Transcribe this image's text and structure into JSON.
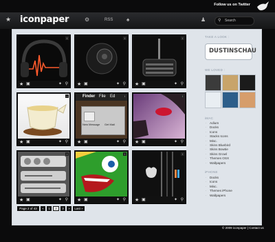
{
  "header": {
    "twitter_text": "Follow us on Twitter",
    "logo": "iconpaper",
    "nav_rss": "RSS",
    "search_placeholder": "Search"
  },
  "tiles": [
    {
      "name": "headphones"
    },
    {
      "name": "speaker"
    },
    {
      "name": "radio"
    },
    {
      "name": "teapot"
    },
    {
      "name": "finder-menu"
    },
    {
      "name": "lips"
    },
    {
      "name": "media-player"
    },
    {
      "name": "green-monster"
    },
    {
      "name": "apple-wallpaper"
    }
  ],
  "finder_tile": {
    "title": "Finder",
    "menu_file": "File",
    "menu_edit": "Ed",
    "btn_new": "New Message",
    "btn_mail": "Get Mail"
  },
  "pager": {
    "label": "Page 2 of 43",
    "prev": "«",
    "p1": "1",
    "p2": "2",
    "p3": "3",
    "next": "»",
    "last": "Last »"
  },
  "sidebar": {
    "take_a_look": "TAKE A LOOK :",
    "dustin": "DUSTINSCHAU",
    "we_loved": "WE LOVED :",
    "imac_heading": "iMAC",
    "imac_items": [
      "Adium",
      "Docks",
      "Icons",
      "Stacks Icons",
      "Misc.",
      "Skins Bluebird",
      "Skins Bowtie",
      "Skins Growl",
      "Themes OSX",
      "Wallpapers"
    ],
    "iphone_heading": "iPHONE",
    "iphone_items": [
      "Docks",
      "Icons",
      "Misc.",
      "Themes iPhone",
      "Wallpapers"
    ]
  },
  "footer": {
    "text": "© 2009 iconpaper | Contact us"
  }
}
